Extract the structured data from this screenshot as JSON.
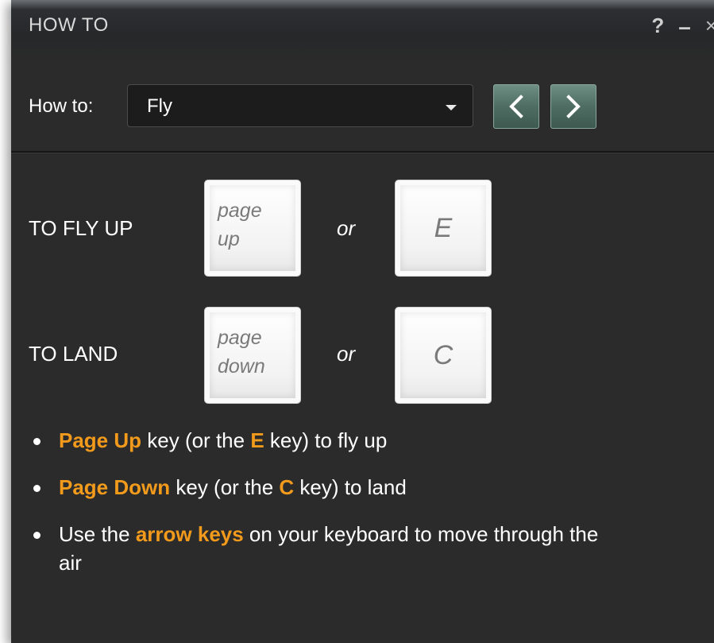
{
  "window": {
    "title": "HOW TO",
    "help_label": "?",
    "minimize_label": "–",
    "close_label": "×"
  },
  "selector": {
    "label": "How to:",
    "value": "Fly",
    "prev_icon": "chevron-left-icon",
    "next_icon": "chevron-right-icon"
  },
  "instructions": [
    {
      "label": "TO FLY UP",
      "key1": [
        "page",
        "up"
      ],
      "or": "or",
      "key2": "E"
    },
    {
      "label": "TO LAND",
      "key1": [
        "page",
        "down"
      ],
      "or": "or",
      "key2": "C"
    }
  ],
  "tips": [
    {
      "hl1": "Page Up",
      "t1": " key (or the ",
      "hl2": "E",
      "t2": " key) to fly up"
    },
    {
      "hl1": "Page Down",
      "t1": " key (or the ",
      "hl2": "C",
      "t2": " key) to land"
    },
    {
      "t0": "Use the ",
      "hl1": "arrow keys",
      "t1": " on your keyboard to move through the air"
    }
  ],
  "colors": {
    "background": "#2b2b2b",
    "highlight": "#f29a1b",
    "nav_button": "#4f6d62"
  }
}
